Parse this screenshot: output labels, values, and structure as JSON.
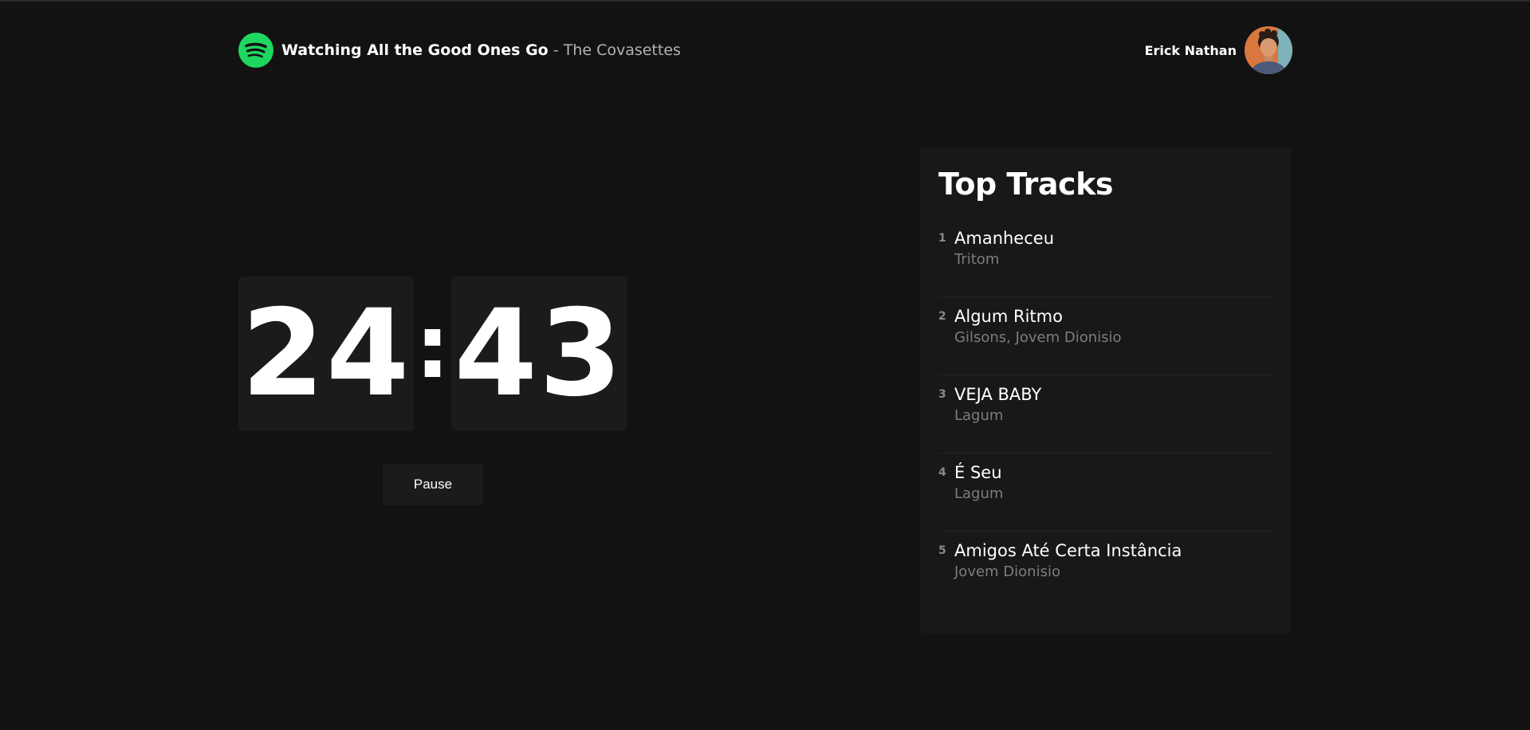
{
  "header": {
    "track_title": "Watching All the Good Ones Go",
    "separator": " - ",
    "track_artist": "The Covasettes",
    "user_name": "Erick Nathan"
  },
  "timer": {
    "minutes": "24",
    "colon": ":",
    "seconds": "43",
    "pause_label": "Pause"
  },
  "top_tracks": {
    "title": "Top Tracks",
    "items": [
      {
        "rank": "1",
        "name": "Amanheceu",
        "artist": "Tritom"
      },
      {
        "rank": "2",
        "name": "Algum Ritmo",
        "artist": "Gilsons, Jovem Dionisio"
      },
      {
        "rank": "3",
        "name": "VEJA BABY",
        "artist": "Lagum"
      },
      {
        "rank": "4",
        "name": "É Seu",
        "artist": "Lagum"
      },
      {
        "rank": "5",
        "name": "Amigos Até Certa Instância",
        "artist": "Jovem Dionisio"
      }
    ]
  },
  "colors": {
    "background": "#121212",
    "accent": "#1ed760",
    "panel": "#181818"
  },
  "icons": {
    "logo": "spotify-icon",
    "avatar": "user-avatar"
  }
}
